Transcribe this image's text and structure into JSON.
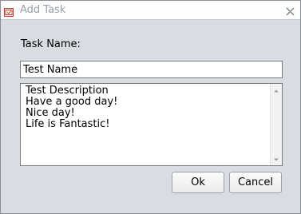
{
  "window": {
    "title": "Add Task",
    "accent_color": "#c0392b"
  },
  "icons": {
    "app": "app-task-icon",
    "close": "close-icon",
    "scroll_up": "arrow-up-icon",
    "scroll_down": "arrow-down-icon"
  },
  "form": {
    "task_name_label": "Task Name:",
    "task_name_value": "Test Name",
    "description_value": "Test Description\nHave a good day!\nNice day!\nLife is Fantastic!"
  },
  "buttons": {
    "ok_label": "Ok",
    "cancel_label": "Cancel"
  }
}
